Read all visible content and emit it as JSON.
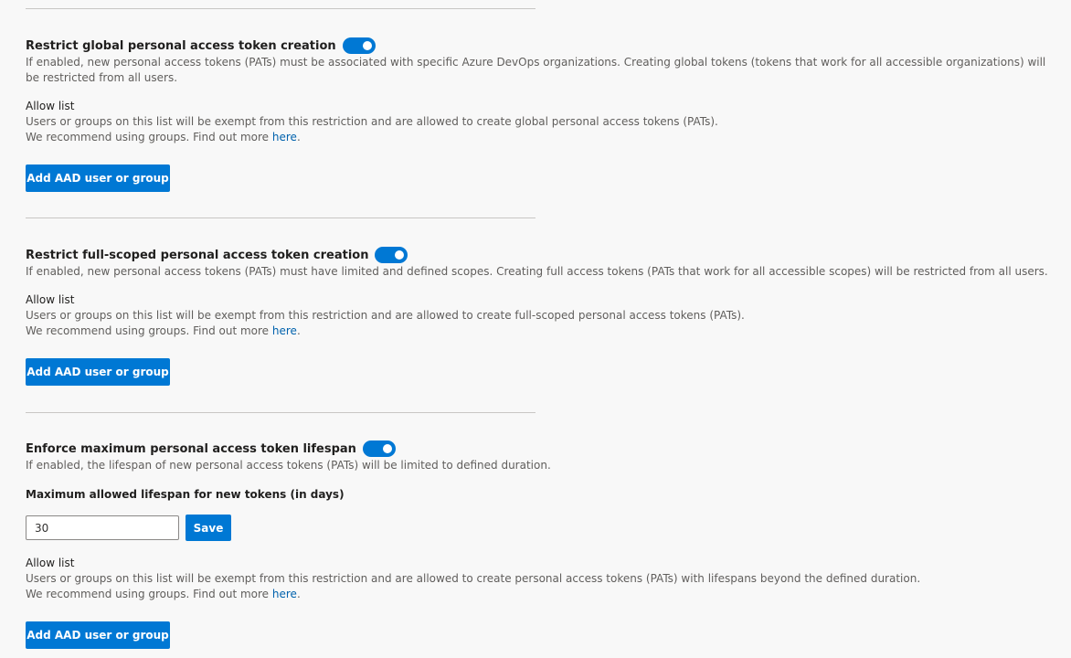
{
  "sections": [
    {
      "title": "Restrict global personal access token creation",
      "toggle_on": true,
      "description": "If enabled, new personal access tokens (PATs) must be associated with specific Azure DevOps organizations. Creating global tokens (tokens that work for all accessible organizations) will be restricted from all users.",
      "allow_list_label": "Allow list",
      "allow_list_text": "Users or groups on this list will be exempt from this restriction and are allowed to create global personal access tokens (PATs).",
      "recommend_text": "We recommend using groups. Find out more ",
      "recommend_link": "here",
      "recommend_suffix": ".",
      "add_button": "Add AAD user or group"
    },
    {
      "title": "Restrict full-scoped personal access token creation",
      "toggle_on": true,
      "description": "If enabled, new personal access tokens (PATs) must have limited and defined scopes. Creating full access tokens (PATs that work for all accessible scopes) will be restricted from all users.",
      "allow_list_label": "Allow list",
      "allow_list_text": "Users or groups on this list will be exempt from this restriction and are allowed to create full-scoped personal access tokens (PATs).",
      "recommend_text": "We recommend using groups. Find out more ",
      "recommend_link": "here",
      "recommend_suffix": ".",
      "add_button": "Add AAD user or group"
    },
    {
      "title": "Enforce maximum personal access token lifespan",
      "toggle_on": true,
      "description": "If enabled, the lifespan of new personal access tokens (PATs) will be limited to defined duration.",
      "lifespan_label": "Maximum allowed lifespan for new tokens (in days)",
      "lifespan_value": "30",
      "save_button": "Save",
      "allow_list_label": "Allow list",
      "allow_list_text": "Users or groups on this list will be exempt from this restriction and are allowed to create personal access tokens (PATs) with lifespans beyond the defined duration.",
      "recommend_text": "We recommend using groups. Find out more ",
      "recommend_link": "here",
      "recommend_suffix": ".",
      "add_button": "Add AAD user or group"
    }
  ],
  "colors": {
    "accent": "#0078d4",
    "link": "#0062ad",
    "background": "#f8f8f8",
    "divider": "#c8c6c4"
  }
}
